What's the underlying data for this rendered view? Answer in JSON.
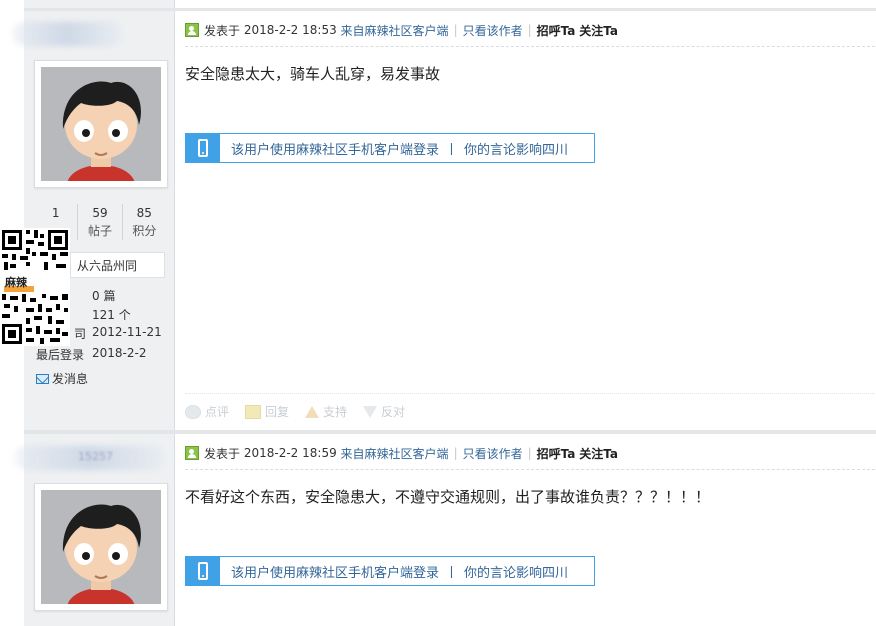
{
  "posts": [
    {
      "author_blur": "",
      "head": {
        "posted_prefix": "发表于",
        "datetime": "2018-2-2 18:53",
        "source": "来自麻辣社区客户端",
        "only_author": "只看该作者",
        "greet": "招呼Ta",
        "follow": "关注Ta"
      },
      "text": "安全隐患太大，骑车人乱穿，易发事故",
      "mobile_banner": {
        "main": "该用户使用麻辣社区手机客户端登录",
        "sep": "丨",
        "tail": "你的言论影响四川"
      }
    },
    {
      "author_blur": "15257",
      "head": {
        "posted_prefix": "发表于",
        "datetime": "2018-2-2 18:59",
        "source": "来自麻辣社区客户端",
        "only_author": "只看该作者",
        "greet": "招呼Ta",
        "follow": "关注Ta"
      },
      "text": "不看好这个东西，安全隐患大，不遵守交通规则，出了事故谁负责？？？！！！",
      "mobile_banner": {
        "main": "该用户使用麻辣社区手机客户端登录",
        "sep": "丨",
        "tail": "你的言论影响四川"
      }
    }
  ],
  "profile": {
    "stats": [
      {
        "value": "1",
        "label": ""
      },
      {
        "value": "59",
        "label": "帖子"
      },
      {
        "value": "85",
        "label": "积分"
      }
    ],
    "hometown": "从六品州同",
    "info": [
      {
        "label": "",
        "value": "0 篇"
      },
      {
        "label": "",
        "value": "121 个"
      },
      {
        "label": "司",
        "value": "2012-11-21"
      },
      {
        "label": "最后登录",
        "value": "2018-2-2"
      }
    ],
    "send_message": "发消息"
  },
  "qr_badge": "麻辣",
  "actions": [
    {
      "label": "点评",
      "icon": "comment-icon"
    },
    {
      "label": "回复",
      "icon": "reply-icon"
    },
    {
      "label": "支持",
      "icon": "thumb-up-icon"
    },
    {
      "label": "反对",
      "icon": "thumb-down-icon"
    }
  ],
  "colors": {
    "link": "#336699",
    "banner_blue": "#41a1e6",
    "sidebar_bg": "#eef0f2"
  }
}
